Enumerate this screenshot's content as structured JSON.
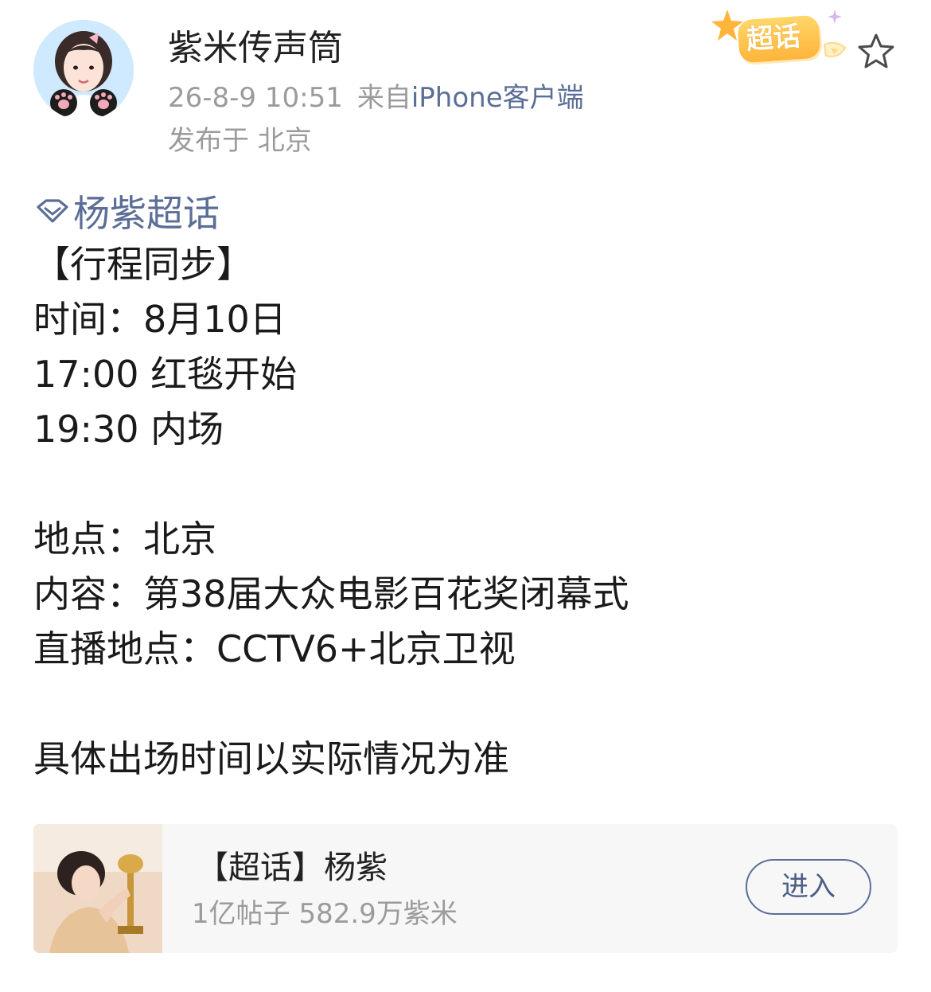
{
  "header": {
    "username": "紫米传声筒",
    "post_time": "26-8-9 10:51",
    "source_prefix": "来自",
    "source_client": "iPhone客户端",
    "location": "发布于 北京",
    "badge_label": "超话",
    "avatar_icon": "avatar-photo",
    "favorite_icon": "star-outline-icon"
  },
  "post": {
    "topic_link": "杨紫超话",
    "topic_icon": "supertopic-diamond-icon",
    "lines": [
      "【行程同步】",
      "时间：8月10日",
      "17:00 红毯开始",
      "19:30 内场",
      "",
      "地点：北京",
      "内容：第38届大众电影百花奖闭幕式",
      "直播地点：CCTV6+北京卫视",
      "",
      "具体出场时间以实际情况为准"
    ]
  },
  "topic_card": {
    "title": "【超话】杨紫",
    "stats": "1亿帖子 582.9万紫米",
    "button_label": "进入"
  },
  "colors": {
    "link": "#5b6e97",
    "meta_gray": "#9b9b9b",
    "badge_orange": "#ffb43a",
    "card_bg": "#f7f7f7"
  }
}
